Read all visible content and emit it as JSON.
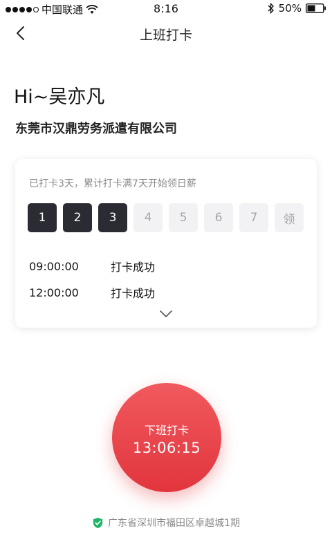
{
  "status_bar": {
    "carrier": "中国联通",
    "time": "8:16",
    "battery": "50%"
  },
  "nav": {
    "title": "上班打卡"
  },
  "greeting": "Hi~吴亦凡",
  "company": "东莞市汉鼎劳务派遣有限公司",
  "card": {
    "hint": "已打卡3天，累计打卡满7天开始领日薪",
    "days": [
      {
        "label": "1",
        "done": true
      },
      {
        "label": "2",
        "done": true
      },
      {
        "label": "3",
        "done": true
      },
      {
        "label": "4",
        "done": false
      },
      {
        "label": "5",
        "done": false
      },
      {
        "label": "6",
        "done": false
      },
      {
        "label": "7",
        "done": false
      },
      {
        "label": "领",
        "done": false
      }
    ],
    "records": [
      {
        "time": "09:00:00",
        "status": "打卡成功"
      },
      {
        "time": "12:00:00",
        "status": "打卡成功"
      }
    ]
  },
  "punch": {
    "label": "下班打卡",
    "time": "13:06:15"
  },
  "location": "广东省深圳市福田区卓越城1期",
  "colors": {
    "accent_red": "#e8434a",
    "dark_day": "#2b2b33",
    "success_green": "#1fb567"
  }
}
